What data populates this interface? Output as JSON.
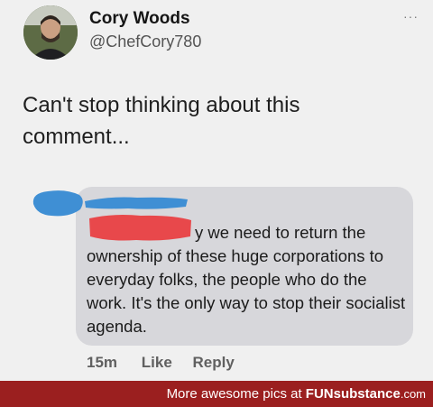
{
  "tweet": {
    "author_name": "Cory Woods",
    "author_handle": "@ChefCory780",
    "more_label": "···",
    "text": "Can't stop thinking about this comment..."
  },
  "comment": {
    "visible_text_tail": "y we need to return the ownership of these huge corporations to everyday folks, the people who do the work. It's the only way to stop their socialist agenda.",
    "timestamp": "15m",
    "like_label": "Like",
    "reply_label": "Reply"
  },
  "watermark": {
    "prefix": "More awesome pics at ",
    "brand_fun": "FUN",
    "brand_substance": "substance",
    "brand_tld": ".com"
  },
  "colors": {
    "background": "#f0f0f0",
    "bubble": "#d7d7db",
    "redaction_red": "#e8484b",
    "redaction_blue": "#3f8fd4",
    "footer": "#9b1f1f"
  },
  "icons": {
    "avatar": "profile-photo",
    "more": "more-horizontal-icon"
  }
}
